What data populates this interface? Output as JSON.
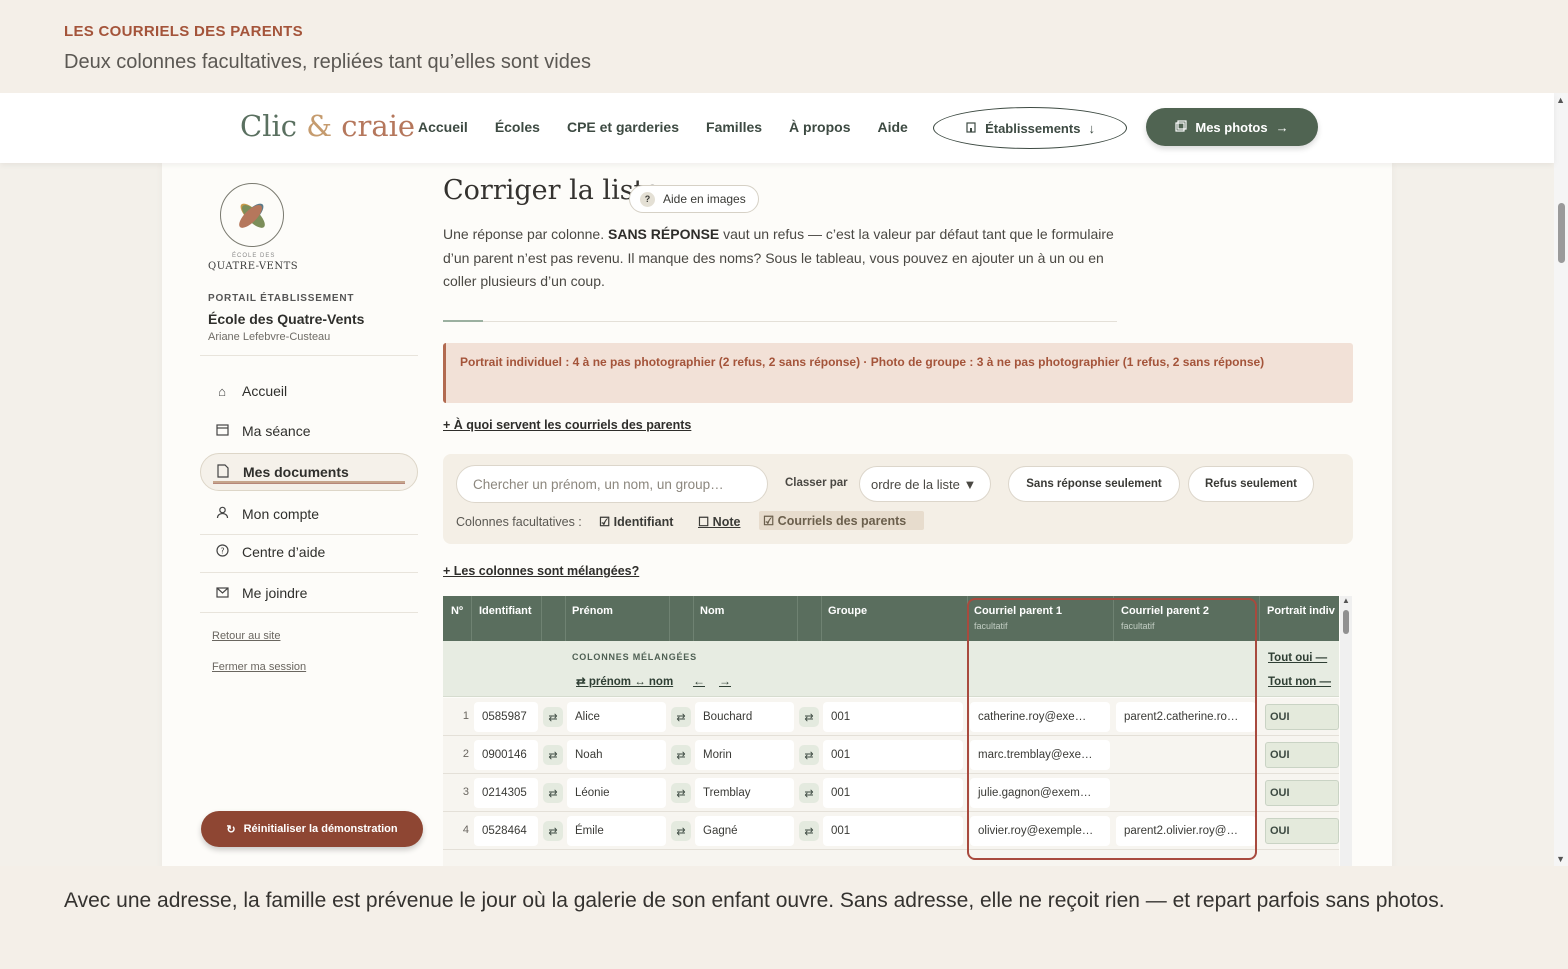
{
  "caption": {
    "kicker": "LES COURRIELS DES PARENTS",
    "subtitle": "Deux colonnes facultatives, repliées tant qu’elles sont vides",
    "bottom": "Avec une adresse, la famille est prévenue le jour où la galerie de son enfant ouvre. Sans adresse, elle ne reçoit rien — et repart parfois sans photos."
  },
  "nav": {
    "logo": {
      "a": "Clic",
      "amp": "&",
      "b": "craie"
    },
    "links": [
      "Accueil",
      "Écoles",
      "CPE et garderies",
      "Familles",
      "À propos",
      "Aide"
    ],
    "etablissements": "Établissements",
    "mes_photos": "Mes photos"
  },
  "sidebar": {
    "logo_small": "ÉCOLE DES",
    "logo_name": "QUATRE-VENTS",
    "portal": "PORTAIL ÉTABLISSEMENT",
    "school": "École des Quatre-Vents",
    "user": "Ariane Lefebvre-Custeau",
    "items": [
      {
        "label": "Accueil",
        "icon": "home-icon"
      },
      {
        "label": "Ma séance",
        "icon": "calendar-icon"
      },
      {
        "label": "Mes documents",
        "icon": "document-icon"
      },
      {
        "label": "Mon compte",
        "icon": "user-icon"
      },
      {
        "label": "Centre d’aide",
        "icon": "help-icon"
      },
      {
        "label": "Me joindre",
        "icon": "mail-icon"
      }
    ],
    "back": "Retour au site",
    "logout": "Fermer ma session",
    "reset": "Réinitialiser la démonstration"
  },
  "main": {
    "title": "Corriger la liste",
    "help_pill": "Aide en images",
    "intro_1": "Une réponse par colonne. ",
    "intro_bold": "SANS RÉPONSE",
    "intro_2": " vaut un refus — c’est la valeur par défaut tant que le formulaire d’un parent n’est pas revenu. Il manque des noms? Sous le tableau, vous pouvez en ajouter un à un ou en coller plusieurs d’un coup.",
    "alert": "Portrait individuel : 4 à ne pas photographier (2 refus, 2 sans réponse) · Photo de groupe : 3 à ne pas photographier (1 refus, 2 sans réponse)",
    "toggle_emails": "+ À quoi servent les courriels des parents",
    "toggle_mixed": "+ Les colonnes sont mélangées?",
    "search_placeholder": "Chercher un prénom, un nom, un group…",
    "sort_label": "Classer par",
    "sort_value": "ordre de la liste ▼",
    "chip_noanswer": "Sans réponse seulement",
    "chip_refus": "Refus seulement",
    "optional_label": "Colonnes facultatives :",
    "opt_id": "☑ Identifiant",
    "opt_note": "☐ Note",
    "opt_emails": "☑ Courriels des parents"
  },
  "table": {
    "headers": {
      "num": "Nº",
      "id": "Identifiant",
      "prenom": "Prénom",
      "nom": "Nom",
      "groupe": "Groupe",
      "email1": "Courriel parent 1",
      "email2": "Courriel parent 2",
      "optional": "facultatif",
      "portrait": "Portrait indiv"
    },
    "mixed_kicker": "COLONNES MÉLANGÉES",
    "mixed_swap": "⇄ prénom ↔ nom",
    "arrow_left": "←",
    "arrow_right": "→",
    "tout_oui": "Tout oui —",
    "tout_non": "Tout non —",
    "rows": [
      {
        "n": "1",
        "id": "0585987",
        "prenom": "Alice",
        "nom": "Bouchard",
        "groupe": "001",
        "email1": "catherine.roy@exe…",
        "email2": "parent2.catherine.ro…",
        "portrait": "OUI"
      },
      {
        "n": "2",
        "id": "0900146",
        "prenom": "Noah",
        "nom": "Morin",
        "groupe": "001",
        "email1": "marc.tremblay@exe…",
        "email2": "",
        "portrait": "OUI"
      },
      {
        "n": "3",
        "id": "0214305",
        "prenom": "Léonie",
        "nom": "Tremblay",
        "groupe": "001",
        "email1": "julie.gagnon@exem…",
        "email2": "",
        "portrait": "OUI"
      },
      {
        "n": "4",
        "id": "0528464",
        "prenom": "Émile",
        "nom": "Gagné",
        "groupe": "001",
        "email1": "olivier.roy@exemple…",
        "email2": "parent2.olivier.roy@…",
        "portrait": "OUI"
      }
    ]
  },
  "colors": {
    "accent_green": "#5a6e5e",
    "accent_rust": "#8e4633",
    "alert_bg": "#f2e1d7"
  }
}
